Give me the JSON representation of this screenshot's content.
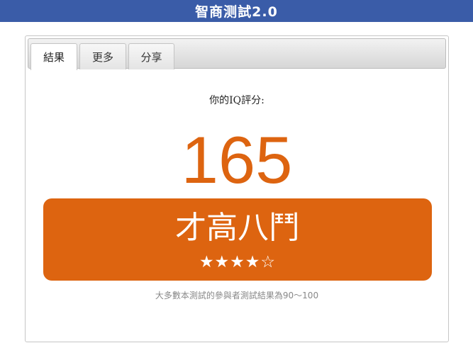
{
  "app": {
    "title": "智商测試2.0"
  },
  "tabs": [
    {
      "label": "結果",
      "active": true
    },
    {
      "label": "更多",
      "active": false
    },
    {
      "label": "分享",
      "active": false
    }
  ],
  "result": {
    "score_label": "你的IQ評分:",
    "score": "165",
    "rating_title": "才高八鬥",
    "stars_text": "★★★★☆",
    "stars_filled": 4,
    "stars_total": 5,
    "footnote": "大多數本測試的參與者測試結果為90～100"
  },
  "colors": {
    "header_bg": "#3a5ca8",
    "accent": "#dd6410",
    "footnote": "#888888"
  }
}
